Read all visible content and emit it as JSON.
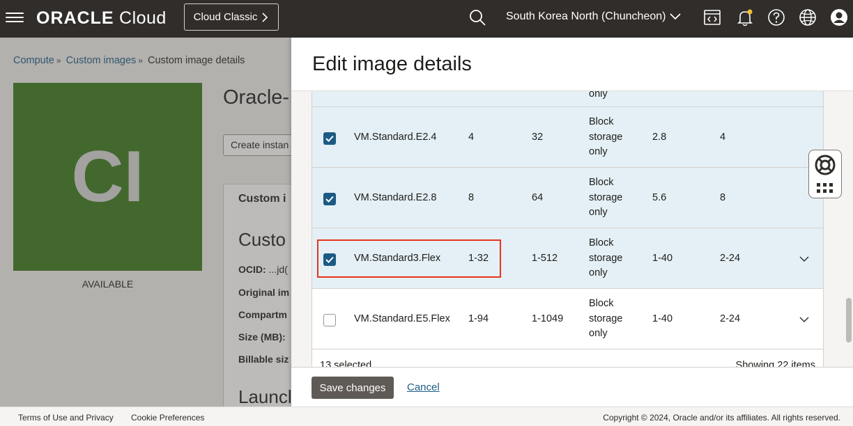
{
  "header": {
    "logo_bold": "ORACLE",
    "logo_light": "Cloud",
    "classic_button": "Cloud Classic",
    "region": "South Korea North (Chuncheon)"
  },
  "background_page": {
    "breadcrumb": [
      "Compute",
      "Custom images",
      "Custom image details"
    ],
    "tile_text": "CI",
    "status": "AVAILABLE",
    "title": "Oracle-",
    "create_button": "Create instan",
    "card_heading": "Custom i",
    "section_heading": "Custo",
    "fields": [
      {
        "label": "OCID:",
        "value": " ...jd("
      },
      {
        "label": "Original im",
        "value": ""
      },
      {
        "label": "Compartm",
        "value": ""
      },
      {
        "label": "Size (MB):",
        "value": ""
      },
      {
        "label": "Billable siz",
        "value": ""
      }
    ],
    "launch_heading": "Launcl"
  },
  "panel": {
    "title": "Edit image details",
    "partial_top_text": "only",
    "rows": [
      {
        "shape": "VM.Standard.E2.4",
        "ocpu": "4",
        "memory": "32",
        "storage": [
          "Block",
          "storage",
          "only"
        ],
        "bandwidth": "2.8",
        "vnics": "4",
        "checked": true,
        "selected": true,
        "expandable": false
      },
      {
        "shape": "VM.Standard.E2.8",
        "ocpu": "8",
        "memory": "64",
        "storage": [
          "Block",
          "storage",
          "only"
        ],
        "bandwidth": "5.6",
        "vnics": "8",
        "checked": true,
        "selected": true,
        "expandable": false
      },
      {
        "shape": "VM.Standard3.Flex",
        "ocpu": "1-32",
        "memory": "1-512",
        "storage": [
          "Block",
          "storage",
          "only"
        ],
        "bandwidth": "1-40",
        "vnics": "2-24",
        "checked": true,
        "selected": true,
        "expandable": true
      },
      {
        "shape": "VM.Standard.E5.Flex",
        "ocpu": "1-94",
        "memory": "1-1049",
        "storage": [
          "Block",
          "storage",
          "only"
        ],
        "bandwidth": "1-40",
        "vnics": "2-24",
        "checked": false,
        "selected": false,
        "expandable": true
      }
    ],
    "selected_count": "13 selected",
    "showing": "Showing 22 items",
    "save_button": "Save changes",
    "cancel_link": "Cancel"
  },
  "footer": {
    "terms": "Terms of Use and Privacy",
    "cookies": "Cookie Preferences",
    "copyright": "Copyright © 2024, Oracle and/or its affiliates. All rights reserved."
  },
  "colors": {
    "topbar": "#312d2a",
    "tile": "#3d7a1f",
    "checkbox": "#1c5a83",
    "selected_row": "#e4f0f5",
    "highlight": "#e8331f"
  }
}
